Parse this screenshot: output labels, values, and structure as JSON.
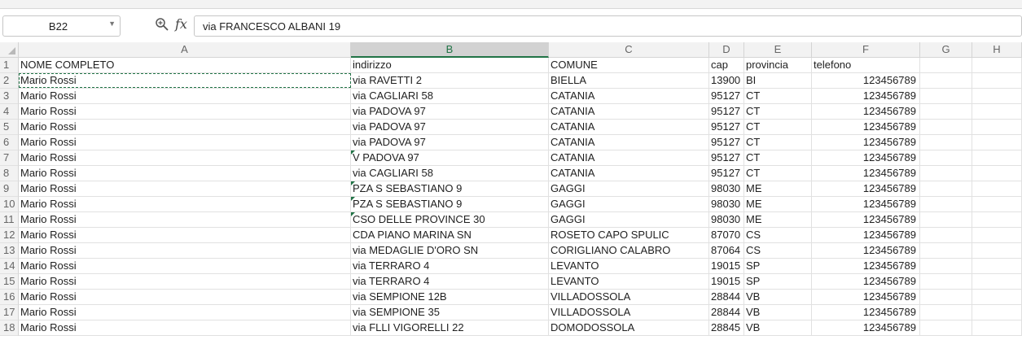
{
  "formula_bar": {
    "name_box": "B22",
    "fx_label": "fx",
    "formula_value": "via FRANCESCO ALBANI 19"
  },
  "columns": [
    "A",
    "B",
    "C",
    "D",
    "E",
    "F",
    "G",
    "H"
  ],
  "selected_column": "B",
  "rows": [
    {
      "n": "1",
      "a": "NOME COMPLETO",
      "b": "indirizzo",
      "c": "COMUNE",
      "d": "cap",
      "e": "provincia",
      "f": "telefono",
      "d_num": false,
      "f_num": false,
      "b_flag": false
    },
    {
      "n": "2",
      "a": "Mario Rossi",
      "b": "via RAVETTI 2",
      "c": "BIELLA",
      "d": "13900",
      "e": "BI",
      "f": "123456789",
      "d_num": true,
      "f_num": true,
      "b_flag": false
    },
    {
      "n": "3",
      "a": "Mario Rossi",
      "b": "via CAGLIARI 58",
      "c": "CATANIA",
      "d": "95127",
      "e": "CT",
      "f": "123456789",
      "d_num": true,
      "f_num": true,
      "b_flag": false
    },
    {
      "n": "4",
      "a": "Mario Rossi",
      "b": "via PADOVA 97",
      "c": "CATANIA",
      "d": "95127",
      "e": "CT",
      "f": "123456789",
      "d_num": true,
      "f_num": true,
      "b_flag": false
    },
    {
      "n": "5",
      "a": "Mario Rossi",
      "b": "via PADOVA 97",
      "c": "CATANIA",
      "d": "95127",
      "e": "CT",
      "f": "123456789",
      "d_num": true,
      "f_num": true,
      "b_flag": false
    },
    {
      "n": "6",
      "a": "Mario Rossi",
      "b": "via PADOVA 97",
      "c": "CATANIA",
      "d": "95127",
      "e": "CT",
      "f": "123456789",
      "d_num": true,
      "f_num": true,
      "b_flag": false
    },
    {
      "n": "7",
      "a": "Mario Rossi",
      "b": " V PADOVA 97",
      "c": "CATANIA",
      "d": "95127",
      "e": "CT",
      "f": "123456789",
      "d_num": true,
      "f_num": true,
      "b_flag": true
    },
    {
      "n": "8",
      "a": "Mario Rossi",
      "b": "via CAGLIARI 58",
      "c": "CATANIA",
      "d": "95127",
      "e": "CT",
      "f": "123456789",
      "d_num": true,
      "f_num": true,
      "b_flag": false
    },
    {
      "n": "9",
      "a": "Mario Rossi",
      "b": " PZA S SEBASTIANO 9",
      "c": "GAGGI",
      "d": "98030",
      "e": "ME",
      "f": "123456789",
      "d_num": true,
      "f_num": true,
      "b_flag": true
    },
    {
      "n": "10",
      "a": "Mario Rossi",
      "b": " PZA S SEBASTIANO 9",
      "c": "GAGGI",
      "d": "98030",
      "e": "ME",
      "f": "123456789",
      "d_num": true,
      "f_num": true,
      "b_flag": true
    },
    {
      "n": "11",
      "a": "Mario Rossi",
      "b": " CSO DELLE PROVINCE 30",
      "c": "GAGGI",
      "d": "98030",
      "e": "ME",
      "f": "123456789",
      "d_num": true,
      "f_num": true,
      "b_flag": true
    },
    {
      "n": "12",
      "a": "Mario Rossi",
      "b": "CDA PIANO MARINA SN",
      "c": "ROSETO CAPO SPULIC",
      "d": "87070",
      "e": "CS",
      "f": "123456789",
      "d_num": true,
      "f_num": true,
      "b_flag": false
    },
    {
      "n": "13",
      "a": "Mario Rossi",
      "b": "via MEDAGLIE D'ORO SN",
      "c": "CORIGLIANO CALABRO",
      "d": "87064",
      "e": "CS",
      "f": "123456789",
      "d_num": true,
      "f_num": true,
      "b_flag": false
    },
    {
      "n": "14",
      "a": "Mario Rossi",
      "b": "via TERRARO 4",
      "c": "LEVANTO",
      "d": "19015",
      "e": "SP",
      "f": "123456789",
      "d_num": true,
      "f_num": true,
      "b_flag": false
    },
    {
      "n": "15",
      "a": "Mario Rossi",
      "b": "via TERRARO 4",
      "c": "LEVANTO",
      "d": "19015",
      "e": "SP",
      "f": "123456789",
      "d_num": true,
      "f_num": true,
      "b_flag": false
    },
    {
      "n": "16",
      "a": "Mario Rossi",
      "b": "via SEMPIONE 12B",
      "c": "VILLADOSSOLA",
      "d": "28844",
      "e": "VB",
      "f": "123456789",
      "d_num": true,
      "f_num": true,
      "b_flag": false
    },
    {
      "n": "17",
      "a": "Mario Rossi",
      "b": "via SEMPIONE 35",
      "c": "VILLADOSSOLA",
      "d": "28844",
      "e": "VB",
      "f": "123456789",
      "d_num": true,
      "f_num": true,
      "b_flag": false
    },
    {
      "n": "18",
      "a": "Mario Rossi",
      "b": "via FLLI VIGORELLI 22",
      "c": "DOMODOSSOLA",
      "d": "28845",
      "e": "VB",
      "f": "123456789",
      "d_num": true,
      "f_num": true,
      "b_flag": false
    }
  ],
  "colors": {
    "accent_green": "#217346",
    "header_bg": "#f2f2f2",
    "selected_header_bg": "#d2d2d2"
  }
}
